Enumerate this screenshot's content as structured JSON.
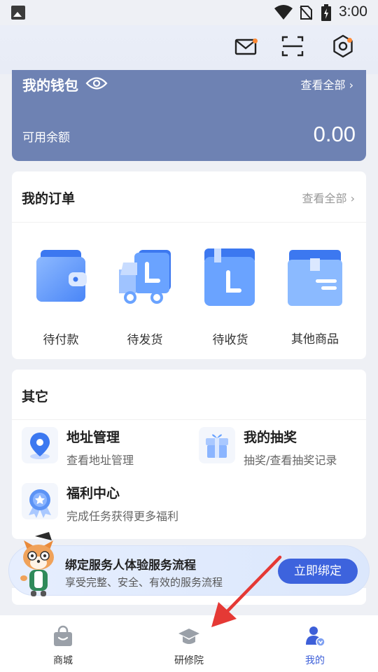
{
  "status_bar": {
    "time": "3:00"
  },
  "header": {
    "icons": [
      "mail-icon",
      "scan-icon",
      "settings-icon"
    ],
    "badge_color": "#ff8a34"
  },
  "wallet": {
    "title": "我的钱包",
    "view_all": "查看全部",
    "balance_label": "可用余额",
    "balance": "0.00",
    "bg_color": "#6e82b3"
  },
  "orders": {
    "title": "我的订单",
    "view_all": "查看全部",
    "items": [
      {
        "label": "待付款",
        "icon": "wallet-icon"
      },
      {
        "label": "待发货",
        "icon": "truck-icon"
      },
      {
        "label": "待收货",
        "icon": "package-icon"
      },
      {
        "label": "其他商品",
        "icon": "box-icon"
      }
    ]
  },
  "others": {
    "title": "其它",
    "items": [
      {
        "title": "地址管理",
        "subtitle": "查看地址管理",
        "icon": "location-icon"
      },
      {
        "title": "我的抽奖",
        "subtitle": "抽奖/查看抽奖记录",
        "icon": "gift-icon"
      },
      {
        "title": "福利中心",
        "subtitle": "完成任务获得更多福利",
        "icon": "medal-icon"
      }
    ]
  },
  "banner": {
    "title": "绑定服务人体验服务流程",
    "subtitle": "享受完整、安全、有效的服务流程",
    "button": "立即绑定",
    "accent": "#3d63dd"
  },
  "tabbar": {
    "items": [
      {
        "label": "商城",
        "icon": "shopping-bag-icon",
        "active": false
      },
      {
        "label": "研修院",
        "icon": "graduation-cap-icon",
        "active": false
      },
      {
        "label": "我的",
        "icon": "user-icon",
        "active": true
      }
    ],
    "active_color": "#3d5fd8"
  }
}
